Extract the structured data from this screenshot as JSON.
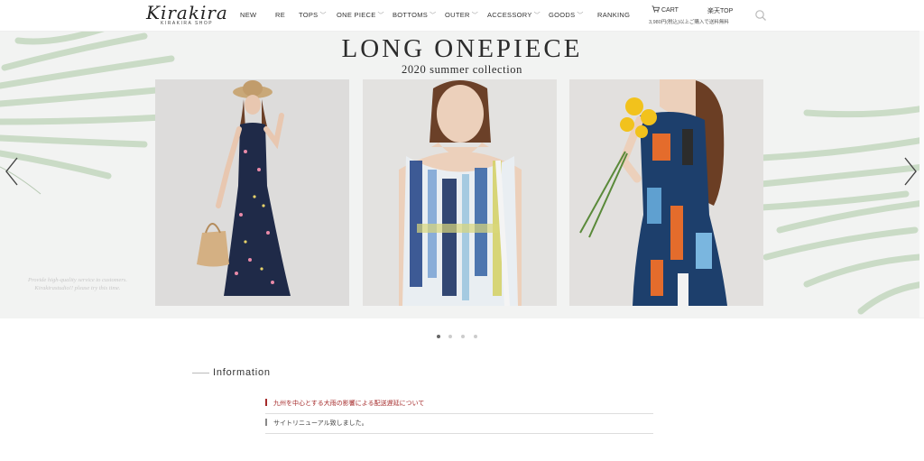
{
  "brand": {
    "script": "Kirakira",
    "sub": "KIRAKIRA SHOP"
  },
  "nav": [
    {
      "label": "NEW",
      "dropdown": false
    },
    {
      "label": "RE",
      "dropdown": false
    },
    {
      "label": "TOPS",
      "dropdown": true
    },
    {
      "label": "ONE PIECE",
      "dropdown": true
    },
    {
      "label": "BOTTOMS",
      "dropdown": true
    },
    {
      "label": "OUTER",
      "dropdown": true
    },
    {
      "label": "ACCESSORY",
      "dropdown": true
    },
    {
      "label": "GOODS",
      "dropdown": true
    },
    {
      "label": "RANKING",
      "dropdown": false
    }
  ],
  "header": {
    "cart_label": "CART",
    "rakuten_label": "楽天TOP",
    "shipping_note": "3,980円(税込)以上ご購入で送料無料",
    "chevron_glyph": "﹀"
  },
  "hero": {
    "title": "LONG ONEPIECE",
    "subtitle": "2020 summer collection",
    "tagline": "Provide high-quality service to customers. Kirakirastudio!! please try this time.",
    "slide_count": 4,
    "active_slide": 1
  },
  "information": {
    "title": "Information",
    "items": [
      {
        "text": "九州を中心とする大雨の影響による配送遅延について",
        "highlight": true
      },
      {
        "text": "サイトリニューアル致しました。",
        "highlight": false
      }
    ]
  },
  "colors": {
    "accent": "#a52a2a",
    "leaf": "#c9dcc5",
    "hero_bg": "#f2f3f2"
  }
}
